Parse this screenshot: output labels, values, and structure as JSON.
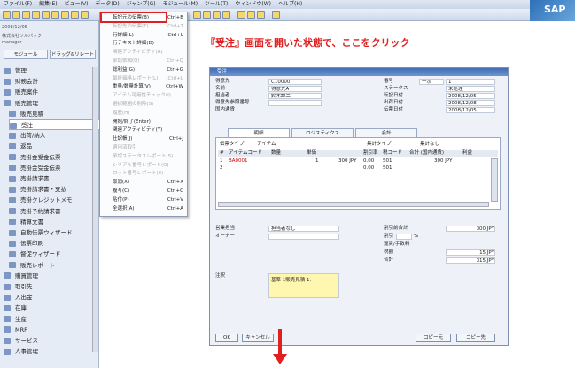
{
  "menubar": [
    "ファイル(F)",
    "編集(E)",
    "ビュー(V)",
    "データ(D)",
    "ジャンプ(G)",
    "モジュール(M)",
    "ツール(T)",
    "ウィンドウ(W)",
    "ヘルプ(H)"
  ],
  "logo": "SAP",
  "sidebar": {
    "date": "2008/12/05",
    "company": "株式会社ソルパック",
    "user": "manager",
    "tab_modules": "モジュール",
    "tab_dragrelate": "ドラッグ&リレート",
    "items": [
      "管理",
      "財務会計",
      "販売案件",
      "販売管理",
      "販売見積",
      "受注",
      "出荷/納入",
      "返品",
      "売掛金受金伝票",
      "売掛金受金伝票",
      "売掛請求書",
      "売掛請求書・支払",
      "売掛クレジットメモ",
      "売掛予約請求書",
      "精算文書",
      "自動伝票ウィザード",
      "伝票印刷",
      "督促ウィザード",
      "販売レポート",
      "購買管理",
      "取引先",
      "入出金",
      "在庫",
      "生産",
      "MRP",
      "サービス",
      "人事管理"
    ]
  },
  "context_menu": {
    "items": [
      {
        "label": "転記元の伝票(B)",
        "shortcut": "Ctrl+B"
      },
      {
        "label": "転記先の伝票(T)",
        "shortcut": "Ctrl+T"
      },
      {
        "label": "行詳細(L)",
        "shortcut": "Ctrl+L"
      },
      {
        "label": "行テキスト詳細(D)",
        "shortcut": ""
      },
      {
        "label": "関連アクティビティ(A)",
        "shortcut": ""
      },
      {
        "label": "承認依頼(Q)",
        "shortcut": "Ctrl+Q"
      },
      {
        "label": "総利益(G)",
        "shortcut": "Ctrl+G"
      },
      {
        "label": "最終価格レポート(L)",
        "shortcut": "Ctrl+L"
      },
      {
        "label": "重量/数量計算(V)",
        "shortcut": "Ctrl+W"
      },
      {
        "label": "アイテム可用性チェック(I)",
        "shortcut": ""
      },
      {
        "label": "選択範囲の削除(S)",
        "shortcut": ""
      },
      {
        "label": "履歴(H)",
        "shortcut": ""
      },
      {
        "label": "開始/終了(Enter)",
        "shortcut": ""
      },
      {
        "label": "関連アクティビティ(Y)",
        "shortcut": ""
      },
      {
        "label": "仕訳帳(J)",
        "shortcut": "Ctrl+J"
      },
      {
        "label": "適用済取引",
        "shortcut": ""
      },
      {
        "label": "承認ステータスレポート(S)",
        "shortcut": ""
      },
      {
        "label": "シリアル番号レポート(O)",
        "shortcut": ""
      },
      {
        "label": "ロット番号レポート(E)",
        "shortcut": ""
      },
      {
        "label": "取消(X)",
        "shortcut": "Ctrl+X"
      },
      {
        "label": "複写(C)",
        "shortcut": "Ctrl+C"
      },
      {
        "label": "貼付(P)",
        "shortcut": "Ctrl+V"
      },
      {
        "label": "全選択(A)",
        "shortcut": "Ctrl+A"
      }
    ]
  },
  "callout": "『受注』画面を開いた状態で、ここをクリック",
  "form": {
    "title": "受注",
    "customer_label": "得意先",
    "customer": "C10000",
    "name_label": "名前",
    "name": "得意先A",
    "contact_label": "担当者",
    "contact": "鈴木課二",
    "ref_label": "得意先参照番号",
    "currency_label": "国内通貨",
    "no_label": "番号",
    "no_series": "一次",
    "no": "1",
    "status_label": "ステータス",
    "status": "未処理",
    "posting_label": "転記日付",
    "posting": "2008/12/05",
    "delivery_label": "出荷日付",
    "delivery": "2008/12/08",
    "doc_label": "伝票日付",
    "doc": "2008/12/05",
    "tabs": [
      "明細",
      "ロジスティクス",
      "会計"
    ],
    "itemtype_label": "伝票タイプ",
    "itemtype": "アイテム",
    "summary_label": "集計タイプ",
    "summary": "集計なし",
    "cols": [
      "#",
      "アイテムコード",
      "数量",
      "単価",
      "割引率",
      "税コード",
      "合計 (国内通貨)",
      "利益"
    ],
    "row1": [
      "1",
      "BA0001",
      "1",
      "300 JPY",
      "0.00",
      "S01",
      "300 JPY"
    ],
    "row2_disc": "0.00",
    "row2_tax": "S01",
    "sales_label": "営業担当",
    "sales": "担当者なし",
    "owner_label": "オーナー",
    "memo_label": "注釈",
    "memo": "基準 1販売見積 1.",
    "pre_disc_label": "割引前合計",
    "pre_disc": "300 JPY",
    "disc_label": "割引",
    "disc_unit": "%",
    "freight_label": "運賃/手数料",
    "tax_label": "税額",
    "tax": "15 JPY",
    "total_label": "合計",
    "total": "315 JPY",
    "ok": "OK",
    "cancel": "キャンセル",
    "copy_from": "コピー元",
    "copy_to": "コピー先"
  }
}
